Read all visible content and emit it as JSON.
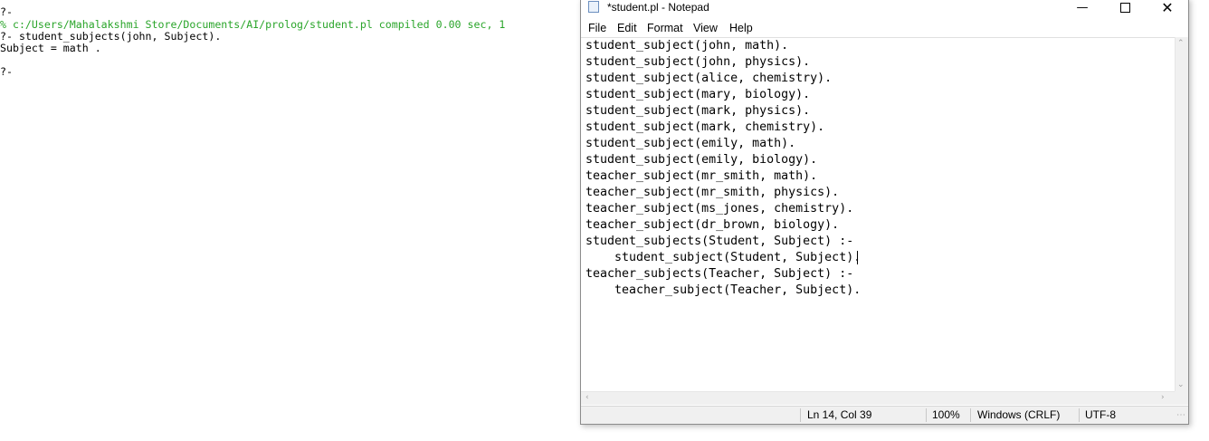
{
  "console": {
    "lines": [
      "?-",
      "% c:/Users/Mahalakshmi Store/Documents/AI/prolog/student.pl compiled 0.00 sec, 1",
      "?- student_subjects(john, Subject).",
      "Subject = math .",
      "",
      "?-"
    ]
  },
  "notepad": {
    "title": "*student.pl - Notepad",
    "menu": [
      "File",
      "Edit",
      "Format",
      "View",
      "Help"
    ],
    "lines": [
      "student_subject(john, math).",
      "student_subject(john, physics).",
      "student_subject(alice, chemistry).",
      "student_subject(mary, biology).",
      "student_subject(mark, physics).",
      "student_subject(mark, chemistry).",
      "student_subject(emily, math).",
      "student_subject(emily, biology).",
      "teacher_subject(mr_smith, math).",
      "teacher_subject(mr_smith, physics).",
      "teacher_subject(ms_jones, chemistry).",
      "teacher_subject(dr_brown, biology).",
      "student_subjects(Student, Subject) :-",
      "    student_subject(Student, Subject).",
      "teacher_subjects(Teacher, Subject) :-",
      "    teacher_subject(Teacher, Subject)."
    ],
    "status": {
      "position": "Ln 14, Col 39",
      "zoom": "100%",
      "line_ending": "Windows (CRLF)",
      "encoding": "UTF-8"
    }
  },
  "colors": {
    "console_path": "#2aa52a"
  }
}
